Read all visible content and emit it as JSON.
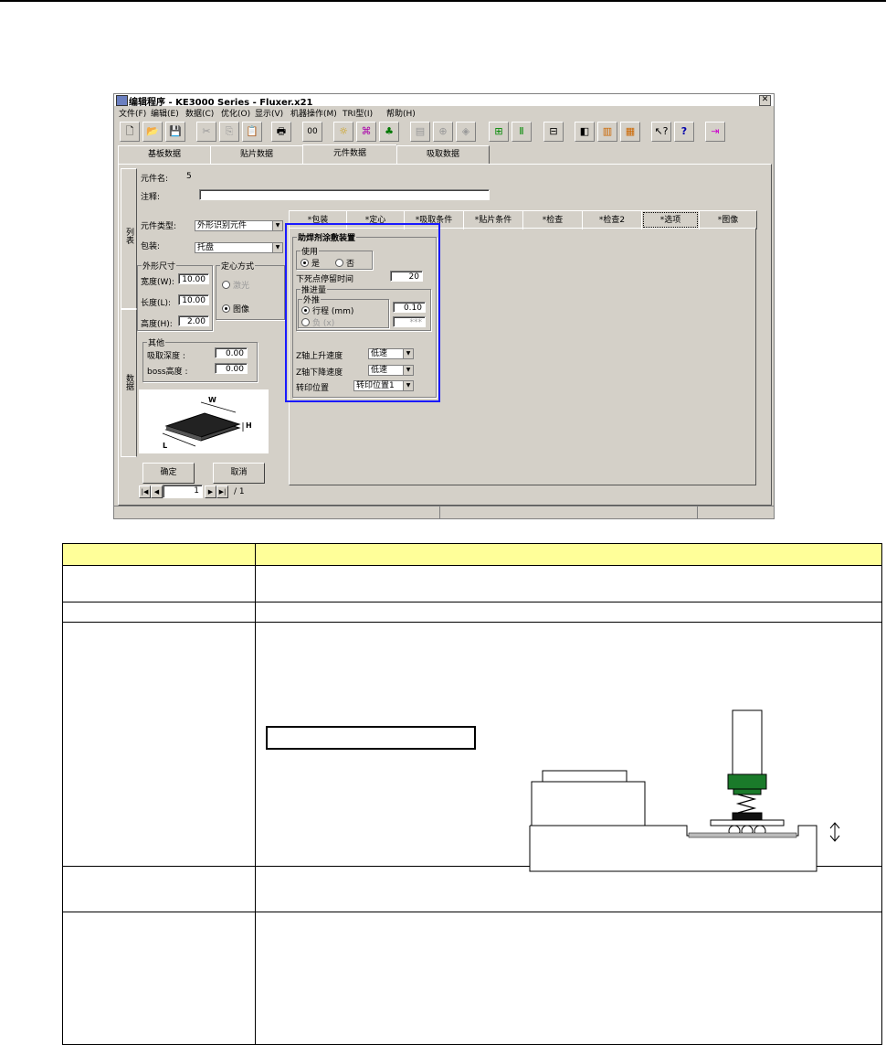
{
  "window": {
    "title": "编辑程序 - KE3000 Series - Fluxer.x21",
    "menu": [
      "文件(F)",
      "编辑(E)",
      "数据(C)",
      "优化(O)",
      "显示(V)",
      "机器操作(M)",
      "TRI型(I)",
      "帮助(H)"
    ],
    "toolbar_icons": [
      "new-icon",
      "open-icon",
      "save-icon",
      "cut-icon",
      "copy-icon",
      "paste-icon",
      "print-icon",
      "goto-icon",
      "light-icon",
      "vision-icon",
      "group-icon",
      "feeder-icon",
      "nozzle-icon",
      "tray-icon",
      "mark-icon",
      "bar-icon",
      "calc-icon",
      "rotate-icon",
      "column-icon",
      "layer-icon",
      "whatsthis-icon",
      "help-icon",
      "exit-icon"
    ],
    "main_tabs": [
      "基板数据",
      "贴片数据",
      "元件数据",
      "吸取数据"
    ],
    "selected_tab": "元件数据"
  },
  "left_panel": {
    "side_tabs": [
      "列表",
      "数据"
    ],
    "component_name_label": "元件名:",
    "component_name_value": "5",
    "comment_label": "注释:",
    "comment_value": "",
    "component_type_label": "元件类型:",
    "component_type_value": "外形识别元件",
    "package_label": "包装:",
    "package_value": "托盘",
    "outline_group": "外形尺寸",
    "width_label": "宽度(W):",
    "width_value": "10.00",
    "length_label": "长度(L):",
    "length_value": "10.00",
    "height_label": "高度(H):",
    "height_value": "2.00",
    "centering_group": "定心方式",
    "centering_laser": "激光",
    "centering_image": "图像",
    "other_group": "其他",
    "pick_depth_label": "吸取深度 :",
    "pick_depth_value": "0.00",
    "boss_height_label": "boss高度 :",
    "boss_height_value": "0.00",
    "ok_button": "确定",
    "cancel_button": "取消",
    "page_value": "1",
    "page_total": "/ 1"
  },
  "sub_tabs": [
    "*包装",
    "*定心",
    "*吸取条件",
    "*贴片条件",
    "*检查",
    "*检查2",
    "*选项",
    "*图像"
  ],
  "selected_sub_tab": "*选项",
  "options_panel": {
    "group_title": "助焊剂涂敷装置",
    "use_group": "使用",
    "use_yes": "是",
    "use_no": "否",
    "dwell_label": "下死点停留时间",
    "dwell_value": "20",
    "push_group": "推进量",
    "outer_group": "外推",
    "stroke_label": "行程 (mm)",
    "stroke_value": "0.10",
    "negative_label": "负 (x)",
    "negative_value": "***",
    "z_up_label": "Z轴上升速度",
    "z_up_value": "低速",
    "z_down_label": "Z轴下降速度",
    "z_down_value": "低速",
    "transfer_label": "转印位置",
    "transfer_value": "转印位置1"
  },
  "colors": {
    "window_bg": "#d4d0c8",
    "highlight_box": "#1a1aff",
    "table_header": "#ffff99",
    "nozzle_green": "#1a7a2a"
  }
}
